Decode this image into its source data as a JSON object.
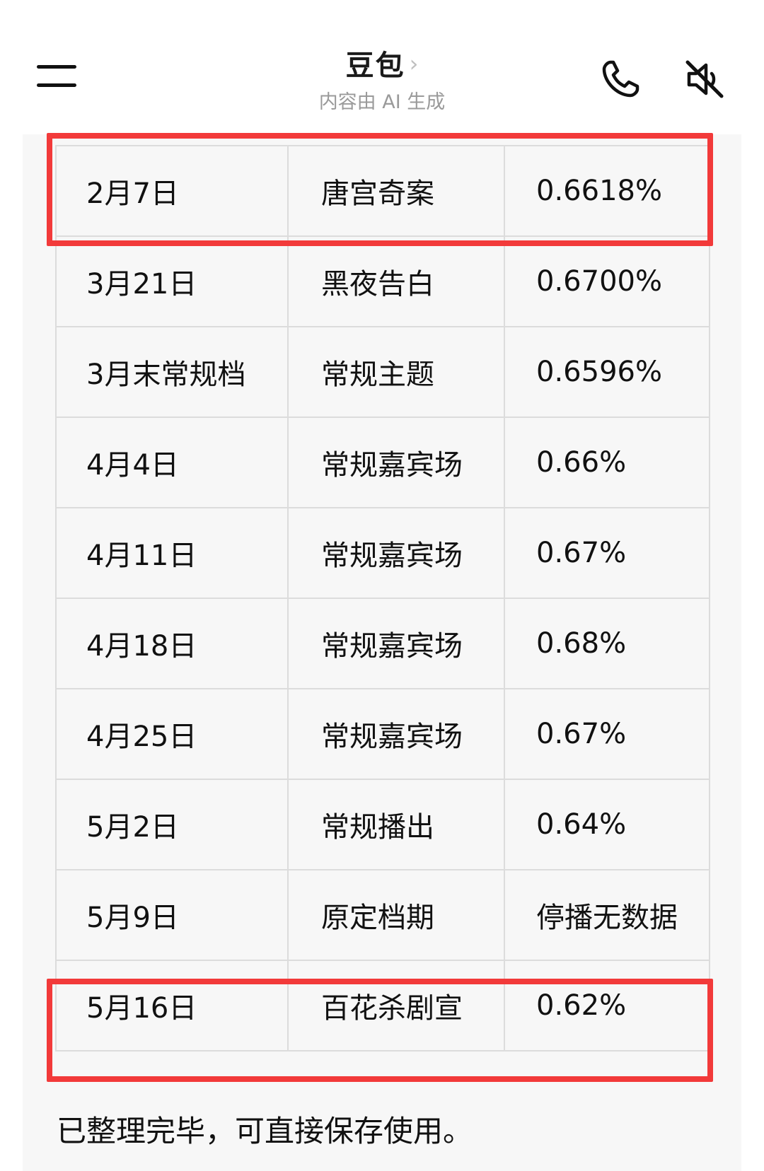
{
  "header": {
    "title": "豆包",
    "subtitle": "内容由 AI 生成",
    "chevron_icon": "chevron-right-icon",
    "menu_icon": "hamburger-menu-icon",
    "call_icon": "phone-icon",
    "mute_icon": "speaker-muted-icon"
  },
  "table": {
    "rows": [
      {
        "date": "2月7日",
        "program": "唐宫奇案",
        "rating": "0.6618%",
        "highlighted": true
      },
      {
        "date": "3月21日",
        "program": "黑夜告白",
        "rating": "0.6700%"
      },
      {
        "date": "3月末常规档",
        "program": "常规主题",
        "rating": "0.6596%"
      },
      {
        "date": "4月4日",
        "program": "常规嘉宾场",
        "rating": "0.66%"
      },
      {
        "date": "4月11日",
        "program": "常规嘉宾场",
        "rating": "0.67%"
      },
      {
        "date": "4月18日",
        "program": "常规嘉宾场",
        "rating": "0.68%"
      },
      {
        "date": "4月25日",
        "program": "常规嘉宾场",
        "rating": "0.67%"
      },
      {
        "date": "5月2日",
        "program": "常规播出",
        "rating": "0.64%"
      },
      {
        "date": "5月9日",
        "program": "原定档期",
        "rating": "停播无数据"
      },
      {
        "date": "5月16日",
        "program": "百花杀剧宣",
        "rating": "0.62%",
        "highlighted": true
      }
    ]
  },
  "footer": {
    "message": "已整理完毕，可直接保存使用。"
  },
  "colors": {
    "highlight": "#f23a3a",
    "panel_bg": "#f7f7f7",
    "grid": "#dcdcdc"
  }
}
